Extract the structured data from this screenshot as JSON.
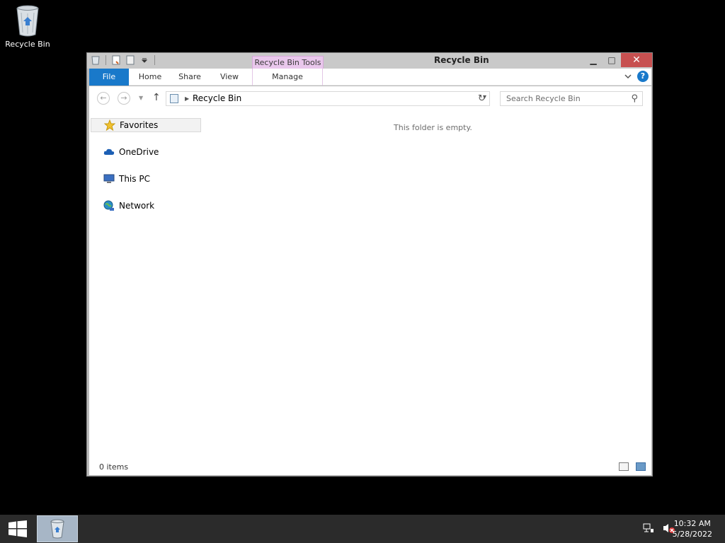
{
  "desktop": {
    "icons": [
      {
        "label": "Recycle Bin",
        "icon": "recycle-bin-icon"
      }
    ]
  },
  "window": {
    "title": "Recycle Bin",
    "contextual_tab_group": "Recycle Bin Tools",
    "controls": {
      "minimize": "▁",
      "maximize": "□",
      "close": "✕"
    }
  },
  "ribbon": {
    "tabs": [
      {
        "label": "File"
      },
      {
        "label": "Home"
      },
      {
        "label": "Share"
      },
      {
        "label": "View"
      },
      {
        "label": "Manage"
      }
    ],
    "help": "?"
  },
  "addressbar": {
    "path": "Recycle Bin",
    "search_placeholder": "Search Recycle Bin"
  },
  "navpane": {
    "items": [
      {
        "label": "Favorites",
        "icon": "star-icon"
      },
      {
        "label": "OneDrive",
        "icon": "cloud-icon"
      },
      {
        "label": "This PC",
        "icon": "computer-icon"
      },
      {
        "label": "Network",
        "icon": "network-icon"
      }
    ]
  },
  "content": {
    "empty_message": "This folder is empty."
  },
  "statusbar": {
    "item_count": "0 items"
  },
  "taskbar": {
    "clock": {
      "time": "10:32 AM",
      "date": "5/28/2022"
    }
  },
  "colors": {
    "accent": "#1979ca",
    "context_tab": "#e9c7ec",
    "close": "#c75050",
    "taskbar": "#2b2b2b"
  }
}
